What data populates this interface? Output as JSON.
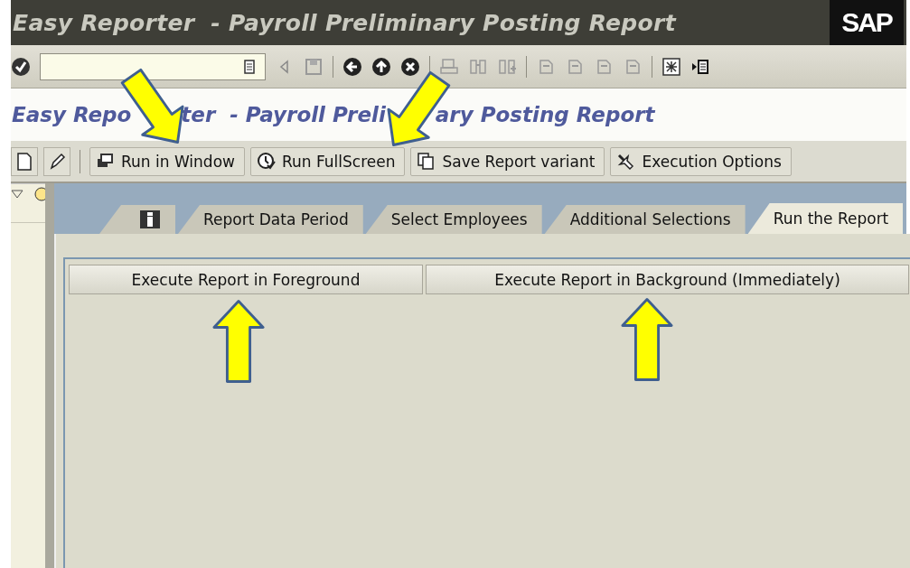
{
  "title_bar": {
    "title": "Easy Reporter  - Payroll Preliminary Posting Report",
    "logo": "SAP"
  },
  "screen_title": [
    "Easy Repo",
    "ter  - Payroll Preli",
    "ary Posting Report"
  ],
  "app_toolbar": {
    "buttons": [
      {
        "label": "Run in Window"
      },
      {
        "label": "Run FullScreen"
      },
      {
        "label": "Save Report variant"
      },
      {
        "label": "Execution Options"
      }
    ]
  },
  "tabs": [
    {
      "kind": "icon",
      "selected": false
    },
    {
      "kind": "text",
      "label": "Report Data Period",
      "selected": false
    },
    {
      "kind": "text",
      "label": "Select Employees",
      "selected": false
    },
    {
      "kind": "text",
      "label": "Additional Selections",
      "selected": false
    },
    {
      "kind": "text",
      "label": "Run the Report",
      "selected": true
    }
  ],
  "actions": [
    {
      "label": "Execute Report in Foreground"
    },
    {
      "label": "Execute Report in Background (Immediately)"
    }
  ]
}
